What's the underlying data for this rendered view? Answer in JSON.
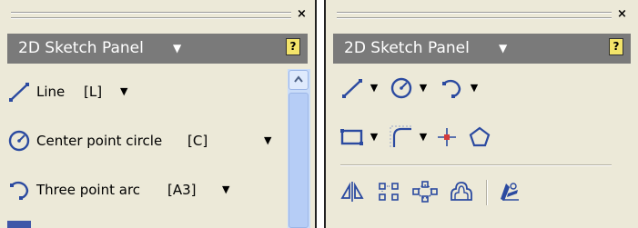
{
  "left_panel": {
    "close_label": "×",
    "title": "2D Sketch Panel",
    "title_caret": "▼",
    "help_label": "?",
    "items": [
      {
        "label": "Line",
        "shortcut": "[L]",
        "icon": "line-icon",
        "dropdown": "▼"
      },
      {
        "label": "Center point circle",
        "shortcut": "[C]",
        "icon": "center-point-circle-icon",
        "dropdown": "▼"
      },
      {
        "label": "Three point arc",
        "shortcut": "[A3]",
        "icon": "three-point-arc-icon",
        "dropdown": "▼"
      }
    ],
    "scroll_up_icon": "scroll-up-arrow-icon"
  },
  "right_panel": {
    "close_label": "×",
    "title": "2D Sketch Panel",
    "title_caret": "▼",
    "help_label": "?",
    "dropdown_glyph": "▼",
    "row1": [
      "line-icon",
      "center-point-circle-icon",
      "three-point-arc-icon"
    ],
    "row2": [
      "two-point-rectangle-icon",
      "fillet-icon",
      "point-center-point-icon",
      "polygon-icon"
    ],
    "row3": [
      "mirror-icon",
      "rectangular-pattern-icon",
      "circular-pattern-icon",
      "offset-icon",
      "edit-coordinate-system-icon"
    ]
  },
  "colors": {
    "panel_bg": "#ece9d8",
    "header_bg": "#7a7a7a",
    "icon_blue": "#2b4aa0",
    "help_yellow": "#f3e46a",
    "scroll_blue": "#c9dcf9"
  }
}
